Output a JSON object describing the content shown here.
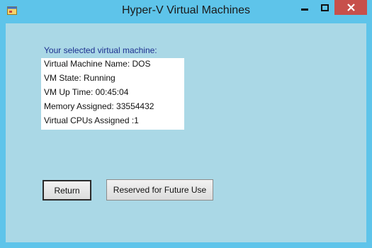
{
  "window": {
    "title": "Hyper-V Virtual Machines",
    "icons": {
      "app": "app-form-icon",
      "minimize": "minimize-icon",
      "maximize": "maximize-icon",
      "close": "close-icon"
    },
    "colors": {
      "frame": "#5ec4ea",
      "client": "#aad8e6",
      "close_button": "#c7504b",
      "label_text": "#1c2f8f"
    }
  },
  "main": {
    "section_label": "Your selected virtual machine:",
    "vm_info": [
      "Virtual Machine Name: DOS",
      "VM State: Running",
      "VM Up Time: 00:45:04",
      "Memory Assigned: 33554432",
      "Virtual CPUs Assigned :1"
    ],
    "buttons": {
      "return_label": "Return",
      "reserved_label": "Reserved for Future Use"
    }
  }
}
